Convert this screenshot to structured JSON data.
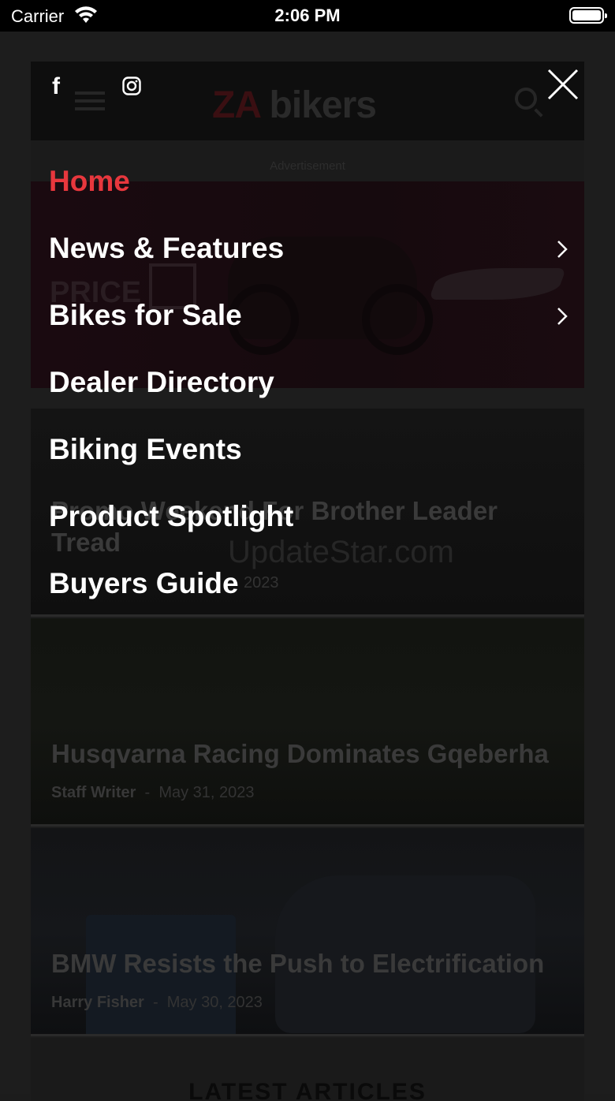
{
  "status_bar": {
    "carrier": "Carrier",
    "time": "2:06 PM"
  },
  "background_page": {
    "logo": {
      "prefix": "ZA",
      "suffix": "bikers"
    },
    "ad_label": "Advertisement",
    "ad_price_text": "PRICE",
    "watermark": "UpdateStar.com",
    "stories": [
      {
        "title": "Promo Weekend For Brother Leader Tread",
        "author": "",
        "date": "2023"
      },
      {
        "title": "Husqvarna Racing Dominates Gqeberha",
        "author": "Staff Writer",
        "date": "May 31, 2023"
      },
      {
        "title": "BMW Resists the Push to Electrification",
        "author": "Harry Fisher",
        "date": "May 30, 2023"
      }
    ],
    "latest_heading": "LATEST ARTICLES"
  },
  "menu": {
    "social": [
      "facebook-icon",
      "instagram-icon"
    ],
    "items": [
      {
        "label": "Home",
        "active": true,
        "has_submenu": false
      },
      {
        "label": "News & Features",
        "active": false,
        "has_submenu": true
      },
      {
        "label": "Bikes for Sale",
        "active": false,
        "has_submenu": true
      },
      {
        "label": "Dealer Directory",
        "active": false,
        "has_submenu": false
      },
      {
        "label": "Biking Events",
        "active": false,
        "has_submenu": false
      },
      {
        "label": "Product Spotlight",
        "active": false,
        "has_submenu": false
      },
      {
        "label": "Buyers Guide",
        "active": false,
        "has_submenu": false
      }
    ]
  },
  "colors": {
    "accent": "#e8373d",
    "overlay": "#000000"
  }
}
